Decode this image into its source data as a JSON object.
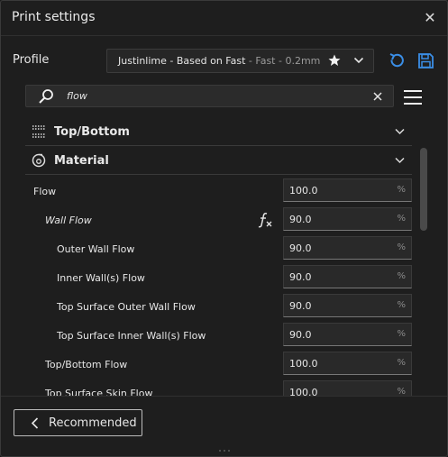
{
  "window": {
    "title": "Print settings"
  },
  "profile": {
    "label": "Profile",
    "name": "Justinlime - Based on Fast",
    "detail": " - Fast - 0.2mm"
  },
  "search": {
    "value": "flow"
  },
  "sections": [
    {
      "title": "Top/Bottom",
      "icon": "top-bottom-icon",
      "expanded": false
    },
    {
      "title": "Material",
      "icon": "material-spool-icon",
      "expanded": true
    }
  ],
  "settings": [
    {
      "label": "Flow",
      "value": "100.0",
      "unit": "%"
    },
    {
      "label": "Wall Flow",
      "value": "90.0",
      "unit": "%"
    },
    {
      "label": "Outer Wall Flow",
      "value": "90.0",
      "unit": "%"
    },
    {
      "label": "Inner Wall(s) Flow",
      "value": "90.0",
      "unit": "%"
    },
    {
      "label": "Top Surface Outer Wall Flow",
      "value": "90.0",
      "unit": "%"
    },
    {
      "label": "Top Surface Inner Wall(s) Flow",
      "value": "90.0",
      "unit": "%"
    },
    {
      "label": "Top/Bottom Flow",
      "value": "100.0",
      "unit": "%"
    },
    {
      "label": "Top Surface Skin Flow",
      "value": "100.0",
      "unit": "%"
    }
  ],
  "footer": {
    "recommended_label": "Recommended"
  },
  "colors": {
    "accent": "#3a8ee6",
    "background": "#1e1e1e",
    "field": "#292929"
  }
}
